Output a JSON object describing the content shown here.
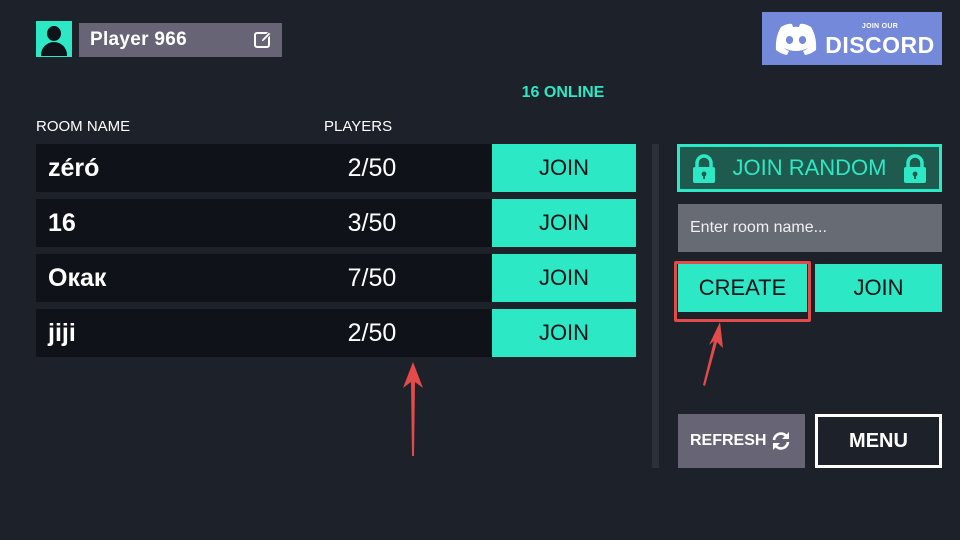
{
  "player": {
    "name": "Player 966"
  },
  "discord": {
    "small_text": "JOIN OUR",
    "big_text": "DISCORD"
  },
  "online_text": "16 ONLINE",
  "columns": {
    "room_name": "ROOM NAME",
    "players": "PLAYERS"
  },
  "rooms": [
    {
      "name": "zéró",
      "players": "2/50",
      "join_label": "JOIN"
    },
    {
      "name": "16",
      "players": "3/50",
      "join_label": "JOIN"
    },
    {
      "name": "Окак",
      "players": "7/50",
      "join_label": "JOIN"
    },
    {
      "name": "jiji",
      "players": "2/50",
      "join_label": "JOIN"
    }
  ],
  "panel": {
    "join_random_label": "JOIN RANDOM",
    "room_input_placeholder": "Enter room name...",
    "create_label": "CREATE",
    "join_label": "JOIN",
    "refresh_label": "REFRESH",
    "menu_label": "MENU"
  },
  "colors": {
    "background": "#1d2129",
    "accent": "#2de8c4",
    "row_bg": "#0f1219",
    "gray_button": "#676575",
    "discord": "#7489da",
    "annotation": "#e34a4a"
  }
}
